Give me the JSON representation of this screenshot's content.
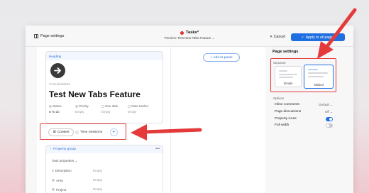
{
  "topbar": {
    "page_settings_label": "Page settings",
    "title": "Tasks*",
    "preview_label": "Preview: Test New Tabs Feature",
    "cancel_label": "Cancel",
    "apply_label": "Apply to all pages"
  },
  "canvas": {
    "heading_label": "Heading",
    "no_backlinks": "No backlinks",
    "page_title": "Test New Tabs Feature",
    "properties": [
      {
        "name": "Status",
        "value": "To do"
      },
      {
        "name": "Priority",
        "value": "Empty"
      },
      {
        "name": "Due date",
        "value": "Empty"
      },
      {
        "name": "Date tracker",
        "value": "Empty"
      }
    ],
    "tabs": [
      {
        "label": "Content",
        "icon": "list-icon"
      },
      {
        "label": "Time Sessions",
        "icon": "info-icon"
      }
    ],
    "add_to_panel_label": "+ Add to panel",
    "property_group": {
      "title": "Property group",
      "section_label": "Task properties",
      "rows": [
        {
          "name": "Description",
          "value": "Empty"
        },
        {
          "name": "Area",
          "value": "Empty"
        },
        {
          "name": "Project",
          "value": "Empty"
        }
      ]
    }
  },
  "sidebar": {
    "title": "Page settings",
    "structure_label": "Structure",
    "structures": [
      {
        "label": "Simple",
        "selected": false
      },
      {
        "label": "Tabbed",
        "selected": true
      }
    ],
    "options_label": "Options",
    "options": [
      {
        "label": "Inline comments",
        "value": "Default"
      },
      {
        "label": "Page discussions",
        "value": "Off"
      },
      {
        "label": "Property icons",
        "toggle": true
      },
      {
        "label": "Full width",
        "toggle": false
      }
    ]
  },
  "colors": {
    "accent": "#1f6fe0",
    "annotation": "#e43a3a",
    "status_dot": "#e0322c"
  }
}
